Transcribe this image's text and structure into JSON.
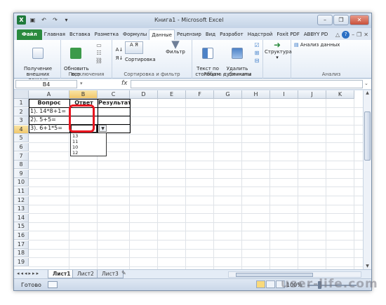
{
  "window": {
    "title": "Книга1 - Microsoft Excel"
  },
  "ribbon_tabs": [
    "Файл",
    "Главная",
    "Вставка",
    "Разметка",
    "Формулы",
    "Данные",
    "Рецензир",
    "Вид",
    "Разработ",
    "Надстрой",
    "Foxit PDF",
    "ABBYY PD"
  ],
  "active_tab": "Данные",
  "ribbon": {
    "get_external": "Получение\nвнешних данных",
    "refresh_all": "Обновить\nвсе",
    "connections_group": "Подключения",
    "sort": "Сортировка",
    "filter": "Фильтр",
    "sort_filter_group": "Сортировка и фильтр",
    "text_to_columns": "Текст по\nстолбцам",
    "remove_duplicates": "Удалить\nдубликаты",
    "data_tools_group": "Работа с данными",
    "outline": "Структура",
    "analysis": "Анализ данных",
    "analysis_group": "Анализ"
  },
  "formula_bar": {
    "name_box": "B4",
    "fx": "fx",
    "formula": ""
  },
  "columns": [
    "A",
    "B",
    "C",
    "D",
    "E",
    "F",
    "G",
    "H",
    "I",
    "J",
    "K"
  ],
  "rows": [
    "1",
    "2",
    "3",
    "4",
    "5",
    "6",
    "7",
    "8",
    "9",
    "10",
    "11",
    "12",
    "13",
    "14",
    "15",
    "16",
    "17",
    "18",
    "19"
  ],
  "cells": {
    "A1": "Вопрос",
    "B1": "Ответ",
    "C1": "Результат",
    "A2": "1). 14*8+1=",
    "A3": "2). 5+5=",
    "A4": "3). 6+1*5="
  },
  "dropdown_options": [
    "13",
    "11",
    "10",
    "12"
  ],
  "sheets": [
    "Лист1",
    "Лист2",
    "Лист3"
  ],
  "active_sheet": "Лист1",
  "status": {
    "ready": "Готово",
    "zoom": "100%"
  },
  "watermark": "user-life.com"
}
